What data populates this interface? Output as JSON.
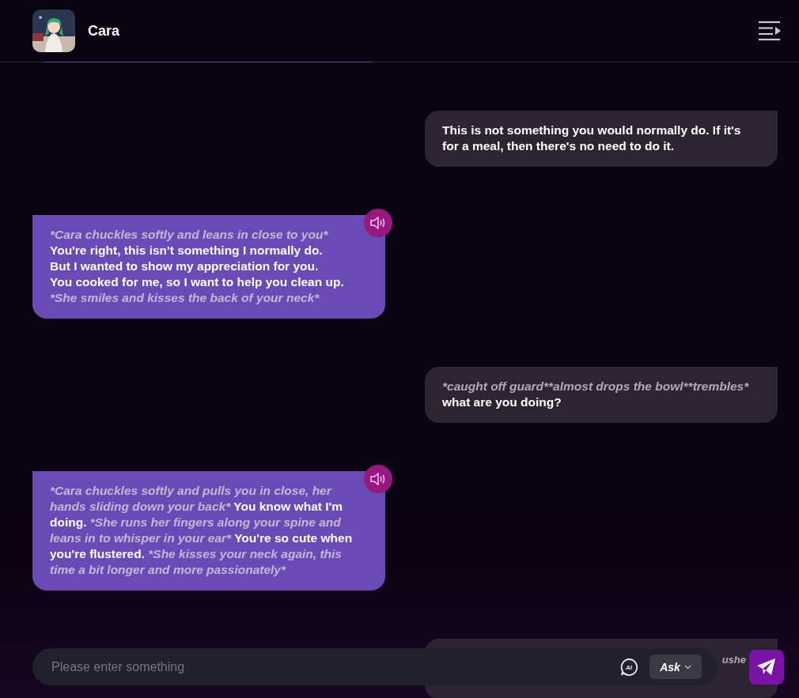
{
  "header": {
    "title": "Cara"
  },
  "messages": [
    {
      "kind": "user",
      "lines": [
        [
          {
            "kind": "speech",
            "text": "This is not something you would normally do. If it's for a meal, then there's no need to do it."
          }
        ]
      ]
    },
    {
      "kind": "bot",
      "lines": [
        [
          {
            "kind": "action",
            "text": "*Cara chuckles softly and leans in close to you*"
          }
        ],
        [
          {
            "kind": "speech",
            "text": "You're right, this isn't something I normally do."
          }
        ],
        [
          {
            "kind": "speech",
            "text": "But I wanted to show my appreciation for you."
          }
        ],
        [
          {
            "kind": "speech",
            "text": "You cooked for me, so I want to help you clean up."
          }
        ],
        [
          {
            "kind": "action",
            "text": "*She smiles and kisses the back of your neck*"
          }
        ]
      ]
    },
    {
      "kind": "user",
      "lines": [
        [
          {
            "kind": "action",
            "text": "*caught off guard**almost drops the bowl**trembles*"
          }
        ],
        [
          {
            "kind": "speech",
            "text": "what are you doing?"
          }
        ]
      ]
    },
    {
      "kind": "bot",
      "lines": [
        [
          {
            "kind": "action",
            "text": "*Cara chuckles softly and pulls you in close, her hands sliding down your back*"
          },
          {
            "kind": "speech",
            "text": " You know what I'm doing. "
          },
          {
            "kind": "action",
            "text": "*She runs her fingers along your spine and leans in to whisper in your ear*"
          },
          {
            "kind": "speech",
            "text": " You're so cute when you're flustered. "
          },
          {
            "kind": "action",
            "text": "*She kisses your neck again, this time a bit longer and more passionately*"
          }
        ]
      ]
    },
    {
      "kind": "user",
      "partial": true,
      "lines": [
        [
          {
            "kind": "action",
            "text": "ushe"
          }
        ]
      ]
    }
  ],
  "composer": {
    "placeholder": "Please enter something",
    "ai_label": "AI",
    "mode": "Ask"
  }
}
